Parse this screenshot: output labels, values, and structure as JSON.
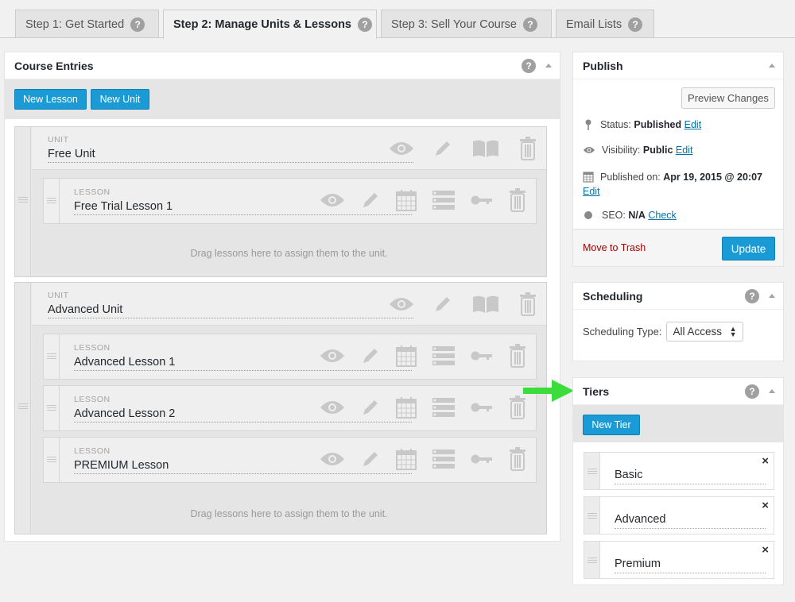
{
  "tabs": [
    {
      "label": "Step 1: Get Started"
    },
    {
      "label": "Step 2: Manage Units & Lessons"
    },
    {
      "label": "Step 3: Sell Your Course"
    },
    {
      "label": "Email Lists"
    }
  ],
  "help_glyph": "?",
  "course_entries": {
    "title": "Course Entries",
    "new_lesson": "New Lesson",
    "new_unit": "New Unit",
    "drag_hint": "Drag lessons here to assign them to the unit.",
    "units": [
      {
        "label": "UNIT",
        "name": "Free Unit",
        "lessons": [
          {
            "label": "LESSON",
            "name": "Free Trial Lesson 1"
          }
        ]
      },
      {
        "label": "UNIT",
        "name": "Advanced Unit",
        "lessons": [
          {
            "label": "LESSON",
            "name": "Advanced Lesson 1"
          },
          {
            "label": "LESSON",
            "name": "Advanced Lesson 2"
          },
          {
            "label": "LESSON",
            "name": "PREMIUM Lesson"
          }
        ]
      }
    ]
  },
  "publish": {
    "title": "Publish",
    "preview": "Preview Changes",
    "status_label": "Status:",
    "status_value": "Published",
    "visibility_label": "Visibility:",
    "visibility_value": "Public",
    "published_label": "Published on:",
    "published_value": "Apr 19, 2015 @ 20:07",
    "seo_label": "SEO:",
    "seo_value": "N/A",
    "seo_link": "Check",
    "edit": "Edit",
    "trash": "Move to Trash",
    "update": "Update"
  },
  "scheduling": {
    "title": "Scheduling",
    "type_label": "Scheduling Type:",
    "type_value": "All Access"
  },
  "tiers": {
    "title": "Tiers",
    "new_tier": "New Tier",
    "items": [
      {
        "name": "Basic"
      },
      {
        "name": "Advanced"
      },
      {
        "name": "Premium"
      }
    ],
    "close_glyph": "×"
  },
  "colors": {
    "accent": "#1a9bd5",
    "arrow": "#3ddc3d",
    "trash": "#aa0000",
    "link": "#0073aa"
  },
  "icons": [
    "eye-icon",
    "pencil-icon",
    "book-icon",
    "trash-icon",
    "calendar-icon",
    "list-icon",
    "key-icon",
    "pin-icon",
    "help-icon",
    "collapse-icon",
    "close-icon",
    "drag-handle-icon"
  ]
}
